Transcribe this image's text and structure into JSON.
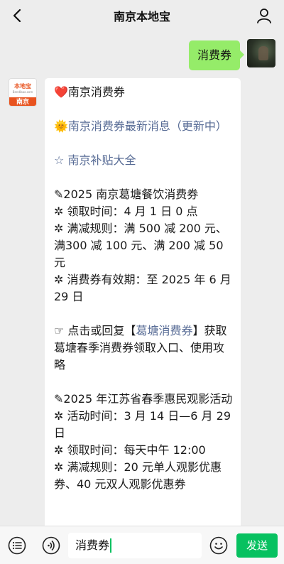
{
  "header": {
    "title": "南京本地宝"
  },
  "outgoing": {
    "text": "消费券"
  },
  "incoming": {
    "avatar_logo": "本地宝",
    "avatar_logo_sub": "Bendibao.com",
    "avatar_city": "南京",
    "heart_glyph": "❤️",
    "title": "南京消费券",
    "sun_glyph": "🌞",
    "news_link": "南京消费券最新消息（更新中）",
    "star_glyph": "☆",
    "subsidy_link": "南京补贴大全",
    "section1": {
      "heading": "✎2025 南京葛塘餐饮消费券",
      "l1": "✲ 领取时间：4 月 1 日 0 点",
      "l2": "✲ 满减规则：满 500 减 200 元、满300 减 100 元、满 200 减 50 元",
      "l3": "✲ 消费券有效期：至 2025 年 6 月 29 日"
    },
    "reply": {
      "prefix": "☞ 点击或回复【",
      "keyword": "葛塘消费券",
      "suffix": "】获取葛塘春季消费券领取入口、使用攻略"
    },
    "section2": {
      "heading": "✎2025 年江苏省春季惠民观影活动",
      "l1": "✲ 活动时间：3 月 14 日—6 月 29 日",
      "l2": "✲ 领取时间：每天中午 12:00",
      "l3": "✲ 满减规则：20 元单人观影优惠券、40 元双人观影优惠券"
    }
  },
  "input": {
    "value": "消费券"
  },
  "send_label": "发送",
  "colors": {
    "bubble_out": "#95ec69",
    "link": "#576b95",
    "send": "#07c160",
    "background": "#ededed"
  },
  "icons": {
    "back": "chevron-left-icon",
    "profile": "person-icon",
    "menu": "menu-list-icon",
    "voice": "voice-icon",
    "emoji": "emoji-icon"
  }
}
